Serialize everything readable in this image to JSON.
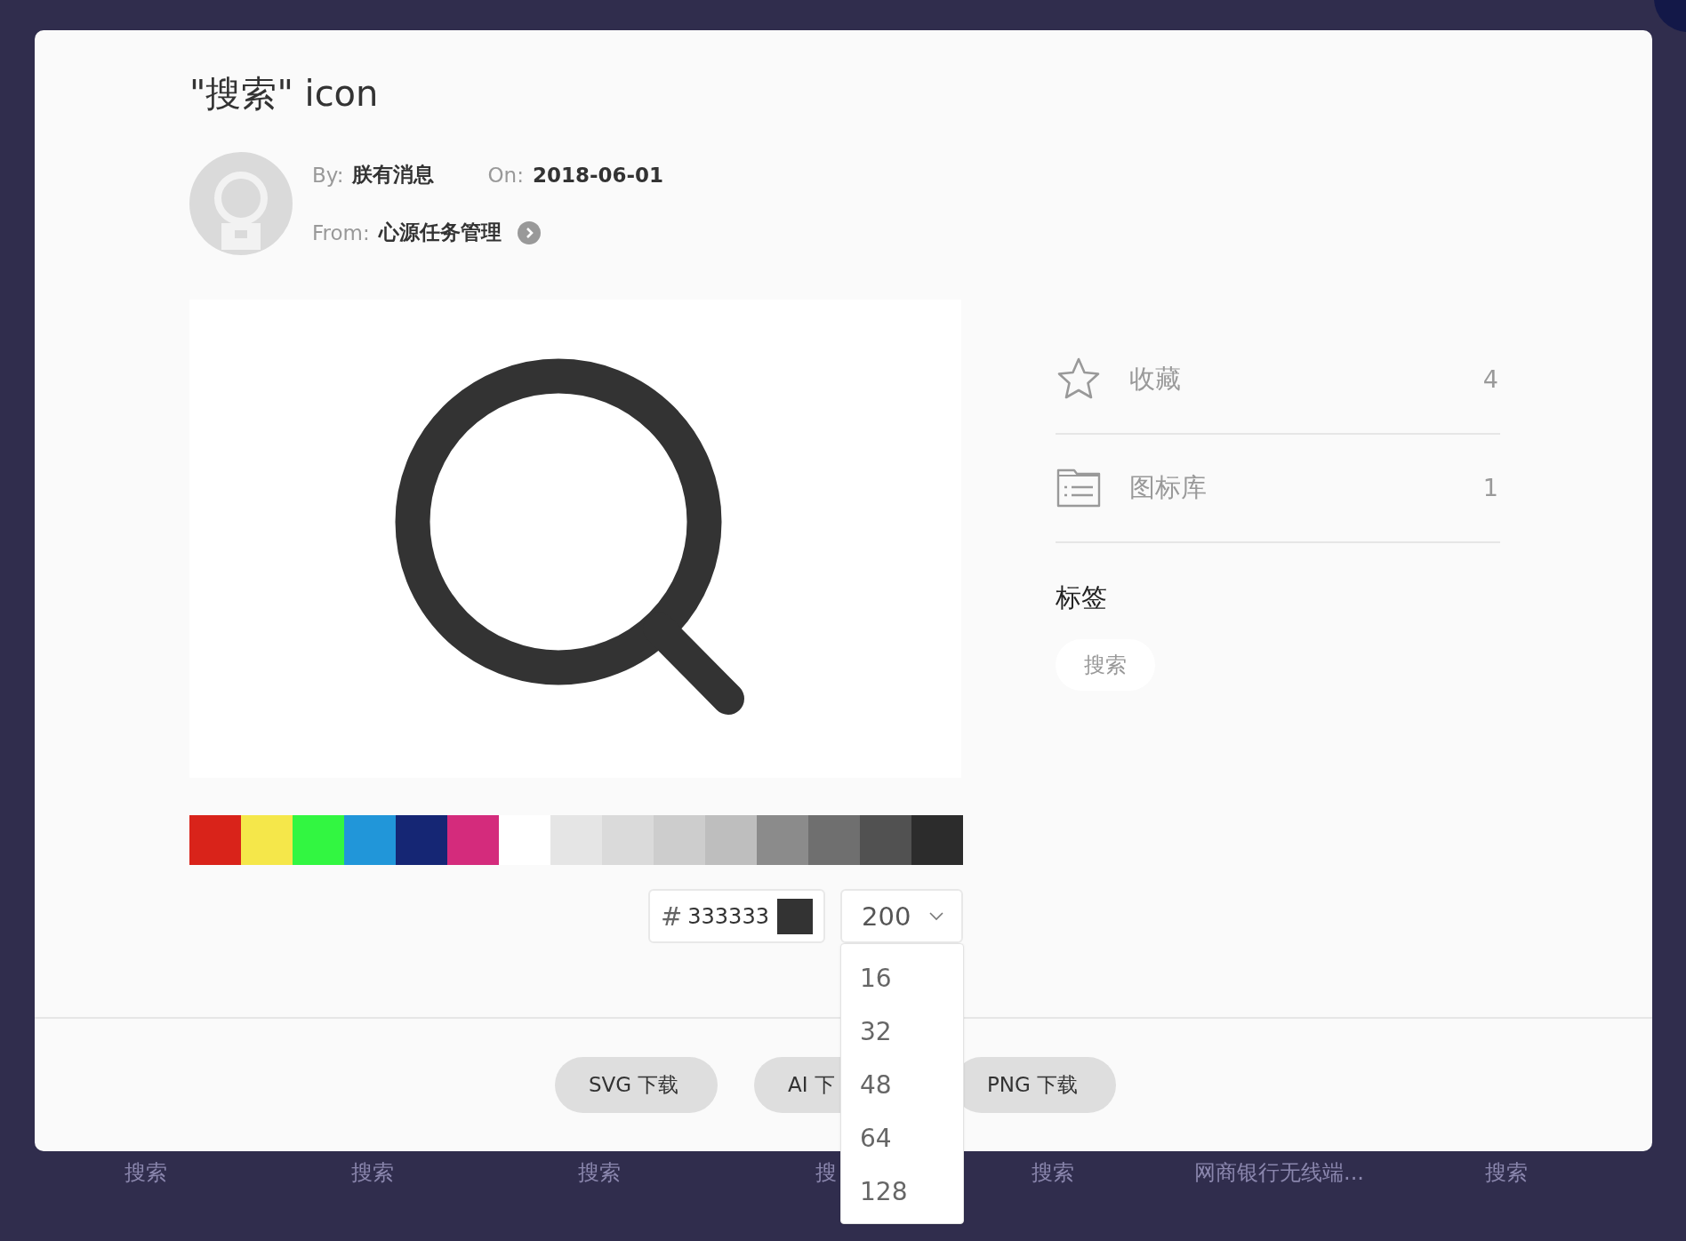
{
  "title": "\"搜索\" icon",
  "meta": {
    "by_label": "By:",
    "by": "朕有消息",
    "on_label": "On:",
    "date": "2018-06-01",
    "from_label": "From:",
    "from": "心源任务管理"
  },
  "stats": [
    {
      "kind": "favorite",
      "label": "收藏",
      "count": "4"
    },
    {
      "kind": "library",
      "label": "图标库",
      "count": "1"
    }
  ],
  "tags_heading": "标签",
  "tags": [
    "搜索"
  ],
  "palette": [
    {
      "color": "#d9231a"
    },
    {
      "color": "#f5e74a"
    },
    {
      "color": "#32f641"
    },
    {
      "color": "#2196d9"
    },
    {
      "color": "#152674"
    },
    {
      "color": "#d42b7c"
    },
    {
      "color": "#ffffff"
    },
    {
      "color": "#e5e5e5"
    },
    {
      "color": "#dadada"
    },
    {
      "color": "#cdcdcd"
    },
    {
      "color": "#bebebe"
    },
    {
      "color": "#8b8b8b"
    },
    {
      "color": "#6f6f6f"
    },
    {
      "color": "#515151"
    },
    {
      "color": "#2c2c2c"
    }
  ],
  "color_field": {
    "prefix": "#",
    "value": "333333",
    "color": "#333333"
  },
  "size_select": {
    "value": "200",
    "expanded": true,
    "options": [
      "16",
      "32",
      "48",
      "64",
      "128"
    ]
  },
  "downloads": [
    "SVG 下载",
    "AI 下",
    "PNG 下载"
  ],
  "background_items": [
    "搜索",
    "搜索",
    "搜索",
    "搜",
    "搜索",
    "网商银行无线端...",
    "搜索"
  ]
}
